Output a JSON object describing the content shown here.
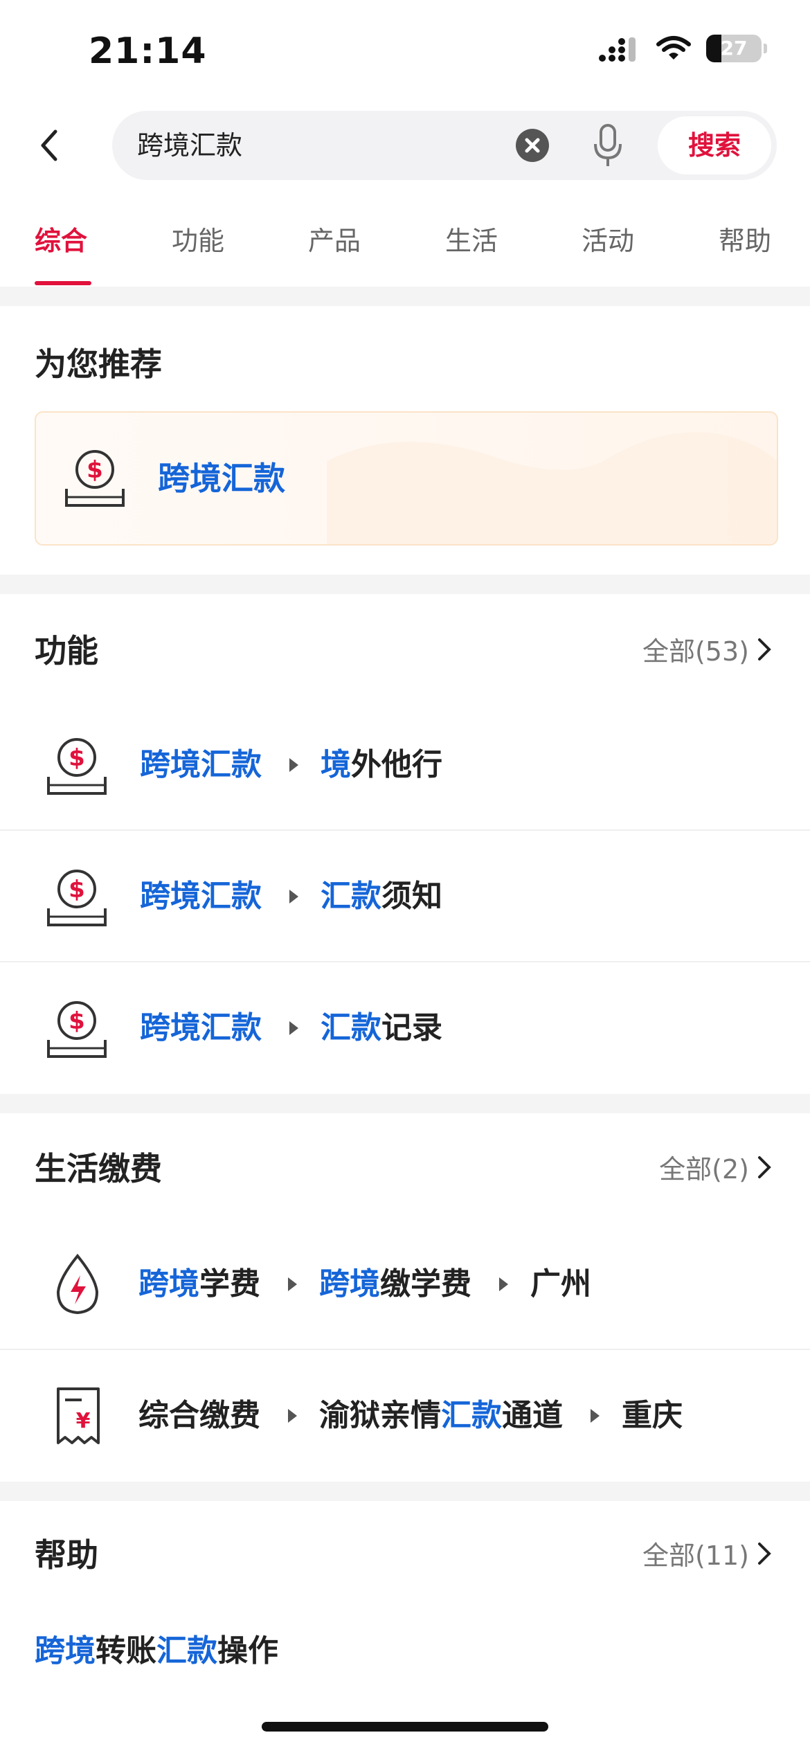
{
  "status_bar": {
    "time": "21:14",
    "battery": "27"
  },
  "search": {
    "query": "跨境汇款",
    "button_label": "搜索"
  },
  "tabs": [
    {
      "label": "综合",
      "active": true
    },
    {
      "label": "功能"
    },
    {
      "label": "产品"
    },
    {
      "label": "生活"
    },
    {
      "label": "活动"
    },
    {
      "label": "帮助"
    }
  ],
  "recommend": {
    "title": "为您推荐",
    "item_label": "跨境汇款",
    "item_icon": "remittance-icon"
  },
  "functions": {
    "title": "功能",
    "more_label": "全部(53)",
    "items": [
      {
        "icon": "remittance-icon",
        "parts": [
          {
            "text": "跨境汇款",
            "hl": true
          },
          {
            "text": "境",
            "hl": true
          },
          {
            "text": "外他行",
            "hl": false
          }
        ]
      },
      {
        "icon": "remittance-icon",
        "parts": [
          {
            "text": "跨境汇款",
            "hl": true
          },
          {
            "text": "汇款",
            "hl": true
          },
          {
            "text": "须知",
            "hl": false
          }
        ]
      },
      {
        "icon": "remittance-icon",
        "parts": [
          {
            "text": "跨境汇款",
            "hl": true
          },
          {
            "text": "汇款",
            "hl": true
          },
          {
            "text": "记录",
            "hl": false
          }
        ]
      }
    ]
  },
  "life_payment": {
    "title": "生活缴费",
    "more_label": "全部(2)",
    "items": [
      {
        "icon": "utility-drop-icon",
        "segments": [
          [
            {
              "text": "跨境",
              "hl": true
            },
            {
              "text": "学费",
              "hl": false
            }
          ],
          [
            {
              "text": "跨境",
              "hl": true
            },
            {
              "text": "缴学费",
              "hl": false
            }
          ],
          [
            {
              "text": "广州",
              "hl": false
            }
          ]
        ]
      },
      {
        "icon": "bill-receipt-icon",
        "segments": [
          [
            {
              "text": "综合缴费",
              "hl": false
            }
          ],
          [
            {
              "text": "渝狱亲情",
              "hl": false
            },
            {
              "text": "汇款",
              "hl": true
            },
            {
              "text": "通道",
              "hl": false
            }
          ],
          [
            {
              "text": "重庆",
              "hl": false
            }
          ]
        ]
      }
    ]
  },
  "help": {
    "title": "帮助",
    "more_label": "全部(11)",
    "item_parts": [
      {
        "text": "跨境",
        "hl": true
      },
      {
        "text": "转账",
        "hl": false
      },
      {
        "text": "汇款",
        "hl": true
      },
      {
        "text": "操作",
        "hl": false
      }
    ]
  },
  "colors": {
    "accent": "#e0123c",
    "highlight": "#1565d8",
    "text": "#222222",
    "muted": "#777777",
    "divider_band": "#f4f4f4"
  }
}
